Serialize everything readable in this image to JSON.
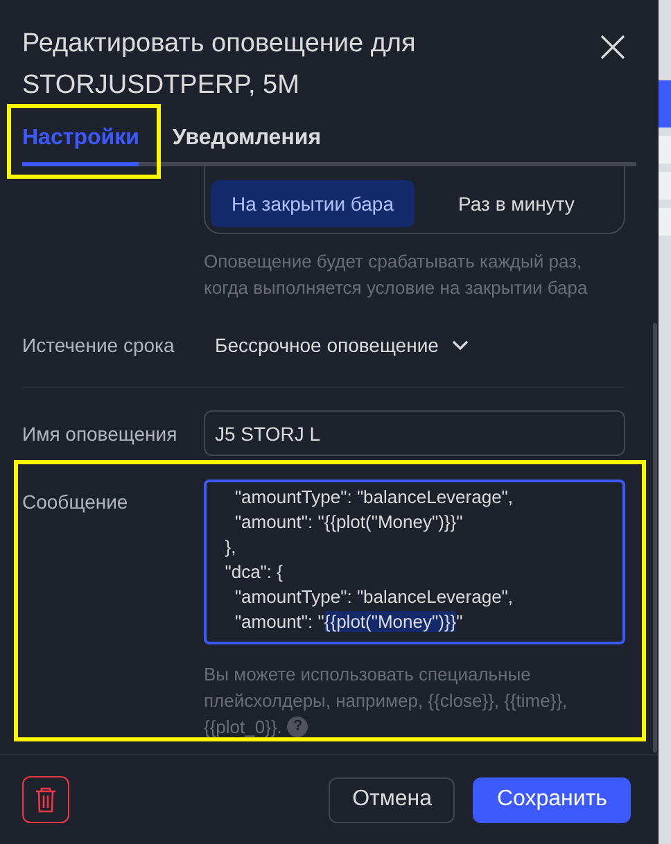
{
  "dialog": {
    "title": "Редактировать оповещение для STORJUSDTPERP, 5M",
    "tabs": [
      {
        "label": "Настройки",
        "selected": true
      },
      {
        "label": "Уведомления",
        "selected": false
      }
    ]
  },
  "trigger": {
    "options": [
      {
        "label": "На закрытии бара",
        "selected": true
      },
      {
        "label": "Раз в минуту",
        "selected": false
      }
    ],
    "hint": "Оповещение будет срабатывать каждый раз, когда выполняется условие на закрытии бара"
  },
  "expiration": {
    "label": "Истечение срока",
    "value": "Бессрочное оповещение"
  },
  "name": {
    "label": "Имя оповещения",
    "value": "J5 STORJ L"
  },
  "message": {
    "label": "Сообщение",
    "focused": true,
    "lines": [
      {
        "before": "    \"amountType\": \"balanceLeverage\","
      },
      {
        "before": "    \"amount\": \"{{plot(\"Money\")}}\""
      },
      {
        "before": "  },"
      },
      {
        "before": "  \"dca\": {"
      },
      {
        "before": "    \"amountType\": \"balanceLeverage\","
      },
      {
        "before": "    \"amount\": \"",
        "selection": "{{plot(\"Money\")}}",
        "after": "\""
      }
    ],
    "hint": [
      "Вы можете использовать специальные плейсхолдеры, например, {{close}}, {{time}},",
      "{{plot_0}}."
    ],
    "help": "?",
    "highlighted": true
  },
  "tabs_highlighted": true,
  "footer": {
    "cancel": "Отмена",
    "save": "Сохранить"
  }
}
